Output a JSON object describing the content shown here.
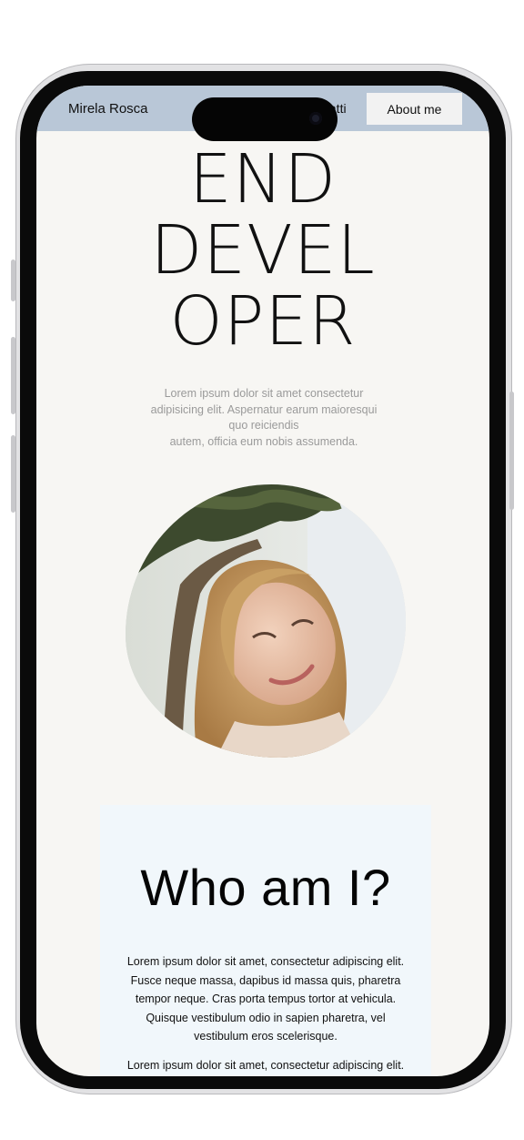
{
  "nav": {
    "brand": "Mirela Rosca",
    "contact_link": "tatti",
    "about_button": "About me",
    "bg_color": "#b9c7d7"
  },
  "hero": {
    "title_lines": [
      "END",
      "DEVEL",
      "OPER"
    ],
    "description_lines": [
      "Lorem ipsum dolor sit amet consectetur",
      "adipisicing elit. Aspernatur earum maioresqui",
      "quo reiciendis",
      "autem, officia eum nobis assumenda."
    ]
  },
  "photo": {
    "icon": "portrait-photo"
  },
  "about": {
    "title": "Who am I?",
    "paragraph_lines": [
      "Lorem ipsum dolor sit amet, consectetur adipiscing elit.",
      "Fusce neque massa, dapibus id massa quis, pharetra",
      "tempor neque. Cras porta tempus tortor at vehicula.",
      "Quisque vestibulum odio in sapien pharetra, vel",
      "vestibulum eros scelerisque."
    ],
    "paragraph2_line": "Lorem ipsum dolor sit amet, consectetur adipiscing elit."
  }
}
